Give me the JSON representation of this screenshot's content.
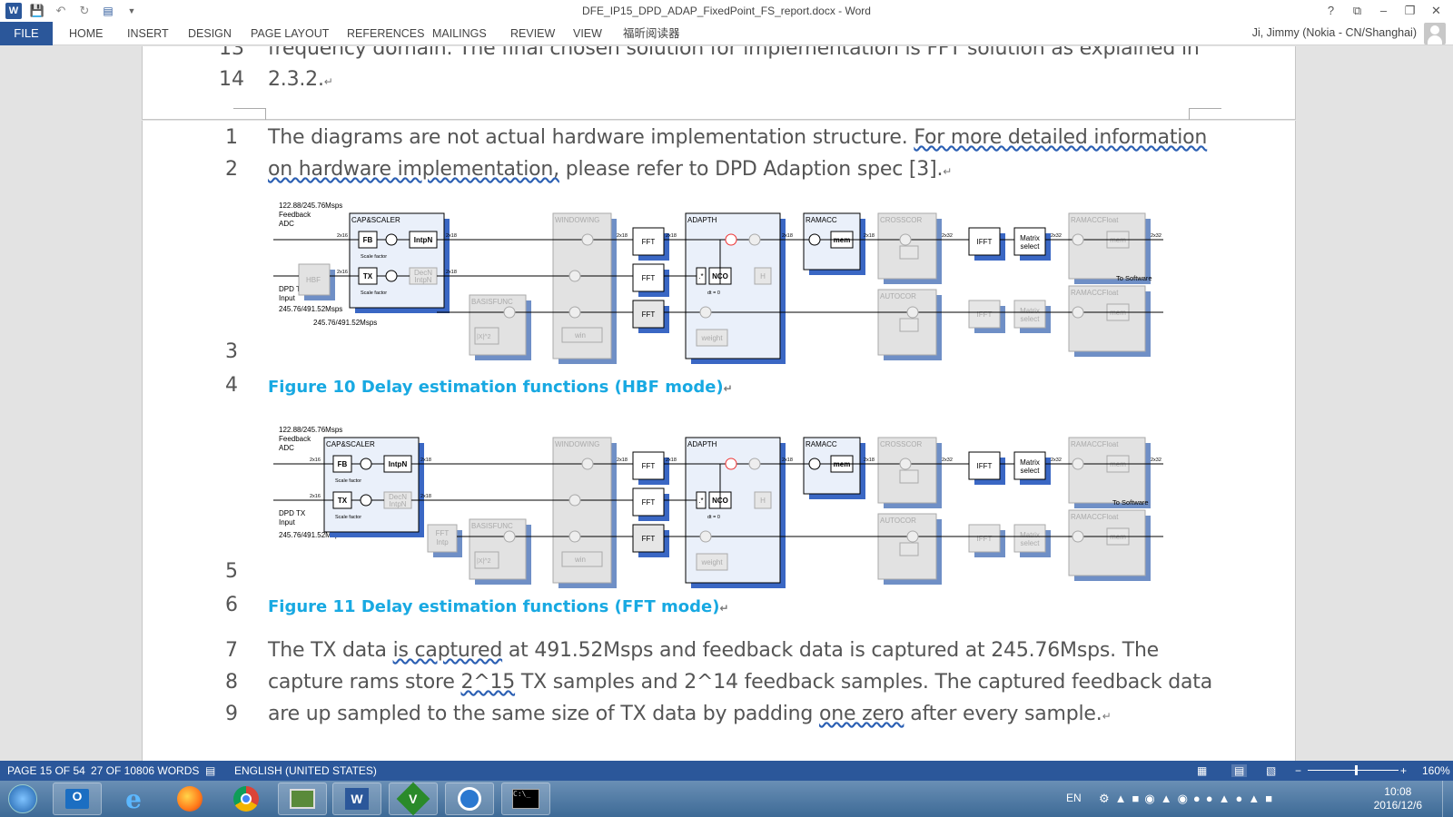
{
  "window": {
    "title": "DFE_IP15_DPD_ADAP_FixedPoint_FS_report.docx - Word",
    "controls": [
      "?",
      "⧉",
      "–",
      "❐",
      "✕"
    ]
  },
  "ribbon": {
    "file": "FILE",
    "tabs": [
      "HOME",
      "INSERT",
      "DESIGN",
      "PAGE LAYOUT",
      "REFERENCES",
      "MAILINGS",
      "REVIEW",
      "VIEW",
      "福昕阅读器"
    ],
    "user": "Ji, Jimmy (Nokia - CN/Shanghai)"
  },
  "page1": {
    "line13_num": "13",
    "line13_text": "frequency domain. The final chosen solution for implementation is FFT solution as explained in",
    "line14_num": "14",
    "line14_text": "2.3.2."
  },
  "page2": {
    "l1": "1",
    "l2": "2",
    "l3": "3",
    "l4": "4",
    "l5": "5",
    "l6": "6",
    "l7": "7",
    "l8": "8",
    "l9": "9",
    "p1a": "The diagrams are not actual hardware implementation structure. ",
    "p1b": "For more detailed information",
    "p2a": "on hardware implementation,",
    "p2b": " please refer to DPD Adaption spec [3].",
    "fig10_caption": "Figure 10 Delay estimation functions (HBF mode)",
    "fig11_caption": "Figure 11 Delay estimation functions (FFT mode)",
    "p7a": "The TX data ",
    "p7b": "is captured",
    "p7c": " at 491.52Msps and feedback data is captured at 245.76Msps. The",
    "p8a": "capture rams store ",
    "p8b": "2^15",
    "p8c": " TX samples and 2^14 feedback samples. The captured feedback data",
    "p9a": "are up sampled to the same size of TX data by padding ",
    "p9b": "one  zero",
    "p9c": " after  every sample."
  },
  "diagram": {
    "feedback_label": "122.88/245.76Msps",
    "feedback_label2": "Feedback",
    "feedback_label3": "ADC",
    "cap_scaler": "CAP&SCALER",
    "fb": "FB",
    "tx": "TX",
    "intpn": "IntpN",
    "decn": "DecN",
    "decn2": "IntpN",
    "scale_factor": "Scale factor",
    "hbf": "HBF",
    "dpd_tx": "DPD TX",
    "input": "Input",
    "rate1": "245.76/491.52Msps",
    "windowing": "WINDOWING",
    "win": "win",
    "basisfunc": "BASISFUNC",
    "x2": "|X|^2",
    "fft": "FFT",
    "adapth": "ADAPTH",
    "nco": "NCO",
    "dt0": "dt = 0",
    "h": "H",
    "weight": "weight",
    "ramacc": "RAMACC",
    "mem": "mem",
    "crosscor": "CROSSCOR",
    "autocor": "AUTOCOR",
    "ifft": "IFFT",
    "matrix": "Matrix",
    "select": "select",
    "ramaccfloat": "RAMACCFloat",
    "to_software": "To Software",
    "fft_intp": "FFT",
    "fft_intp2": "Intp",
    "bw16": "2x16",
    "bw18": "2x18",
    "bw32": "2x32",
    "conj": ".*",
    "star": "*"
  },
  "status": {
    "page": "PAGE 15 OF 54",
    "words": "27 OF 10806 WORDS",
    "lang": "ENGLISH (UNITED STATES)",
    "zoom": "160%",
    "zoom_minus": "−",
    "zoom_plus": "+"
  },
  "taskbar": {
    "lang": "EN",
    "time": "10:08",
    "date": "2016/12/6"
  }
}
